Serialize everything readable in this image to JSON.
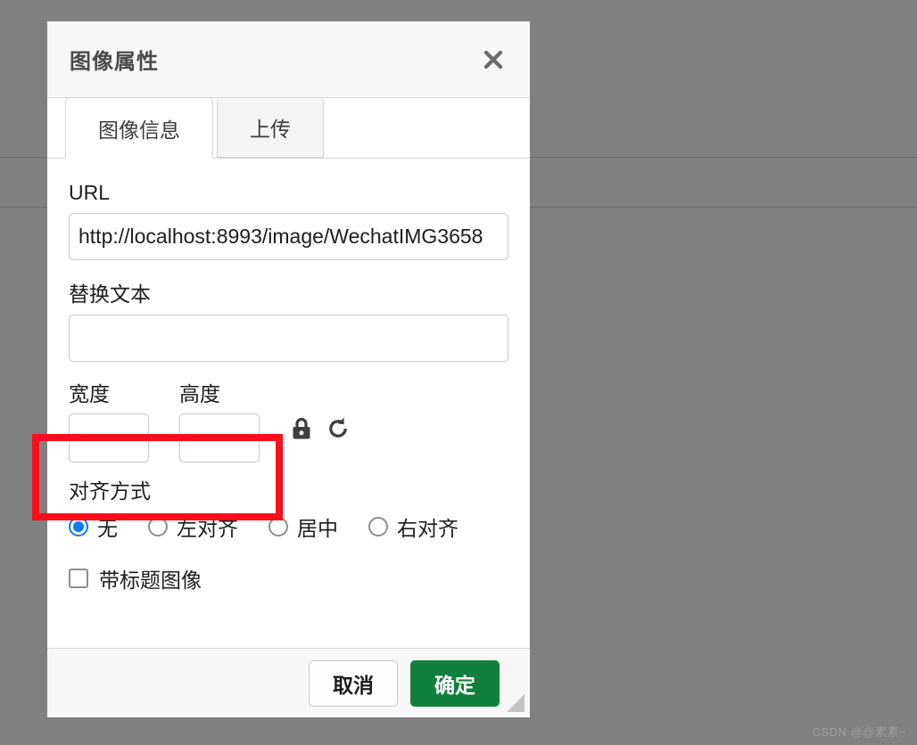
{
  "background": {
    "color": "#808080",
    "rule_color": "#6b6b6b"
  },
  "dialog": {
    "title": "图像属性",
    "close_icon": "close-icon",
    "tabs": [
      {
        "label": "图像信息",
        "active": true
      },
      {
        "label": "上传",
        "active": false
      }
    ],
    "fields": {
      "url": {
        "label": "URL",
        "value": "http://localhost:8993/image/WechatIMG3658",
        "placeholder": ""
      },
      "alt": {
        "label": "替换文本",
        "value": "",
        "placeholder": ""
      },
      "width": {
        "label": "宽度",
        "value": "",
        "placeholder": ""
      },
      "height": {
        "label": "高度",
        "value": "",
        "placeholder": ""
      },
      "lock_icon": "lock-icon",
      "reset_icon": "reset-icon"
    },
    "alignment": {
      "label": "对齐方式",
      "selected": "无",
      "accent_color": "#0f7bf2",
      "options": [
        {
          "label": "无",
          "checked": true
        },
        {
          "label": "左对齐",
          "checked": false
        },
        {
          "label": "居中",
          "checked": false
        },
        {
          "label": "右对齐",
          "checked": false
        }
      ]
    },
    "caption": {
      "label": "带标题图像",
      "checked": false
    },
    "footer": {
      "cancel_label": "取消",
      "ok_label": "确定",
      "ok_color": "#10803c",
      "resize_grip_icon": "resize-grip-icon"
    }
  },
  "annotation": {
    "color": "#fc0d1b",
    "target": "宽度 / 高度"
  },
  "watermark": {
    "text": "CSDN @@素素~"
  }
}
